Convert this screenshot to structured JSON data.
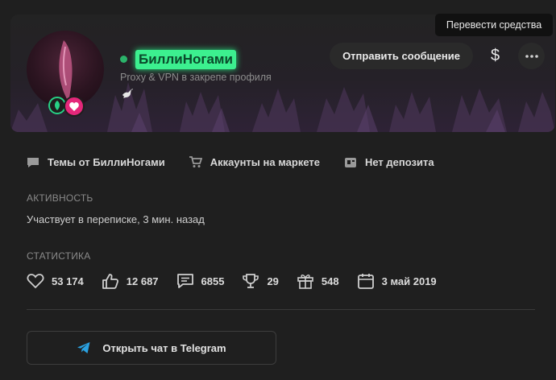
{
  "tooltip": {
    "text": "Перевести средства"
  },
  "profile": {
    "username": "БиллиНогами",
    "status_text": "Proxy & VPN в закрепе профиля",
    "online_color": "#2bb36a",
    "username_color": "#3cf08f"
  },
  "actions": {
    "send_message": "Отправить сообщение",
    "money_symbol": "$",
    "more_icon": "more-dots-icon"
  },
  "links": [
    {
      "label": "Темы от БиллиНогами",
      "icon": "chat-bubble-icon"
    },
    {
      "label": "Аккаунты на маркете",
      "icon": "cart-icon"
    },
    {
      "label": "Нет депозита",
      "icon": "deposit-icon"
    }
  ],
  "activity": {
    "heading": "АКТИВНОСТЬ",
    "text": "Участвует в переписке, 3 мин. назад"
  },
  "stats": {
    "heading": "СТАТИСТИКА",
    "items": [
      {
        "icon": "heart-icon",
        "value": "53 174"
      },
      {
        "icon": "thumbs-up-icon",
        "value": "12 687"
      },
      {
        "icon": "message-icon",
        "value": "6855"
      },
      {
        "icon": "trophy-icon",
        "value": "29"
      },
      {
        "icon": "gift-icon",
        "value": "548"
      },
      {
        "icon": "calendar-icon",
        "value": "3 май 2019"
      }
    ]
  },
  "telegram": {
    "label": "Открыть чат в Telegram",
    "icon_color": "#2aa1e0"
  }
}
